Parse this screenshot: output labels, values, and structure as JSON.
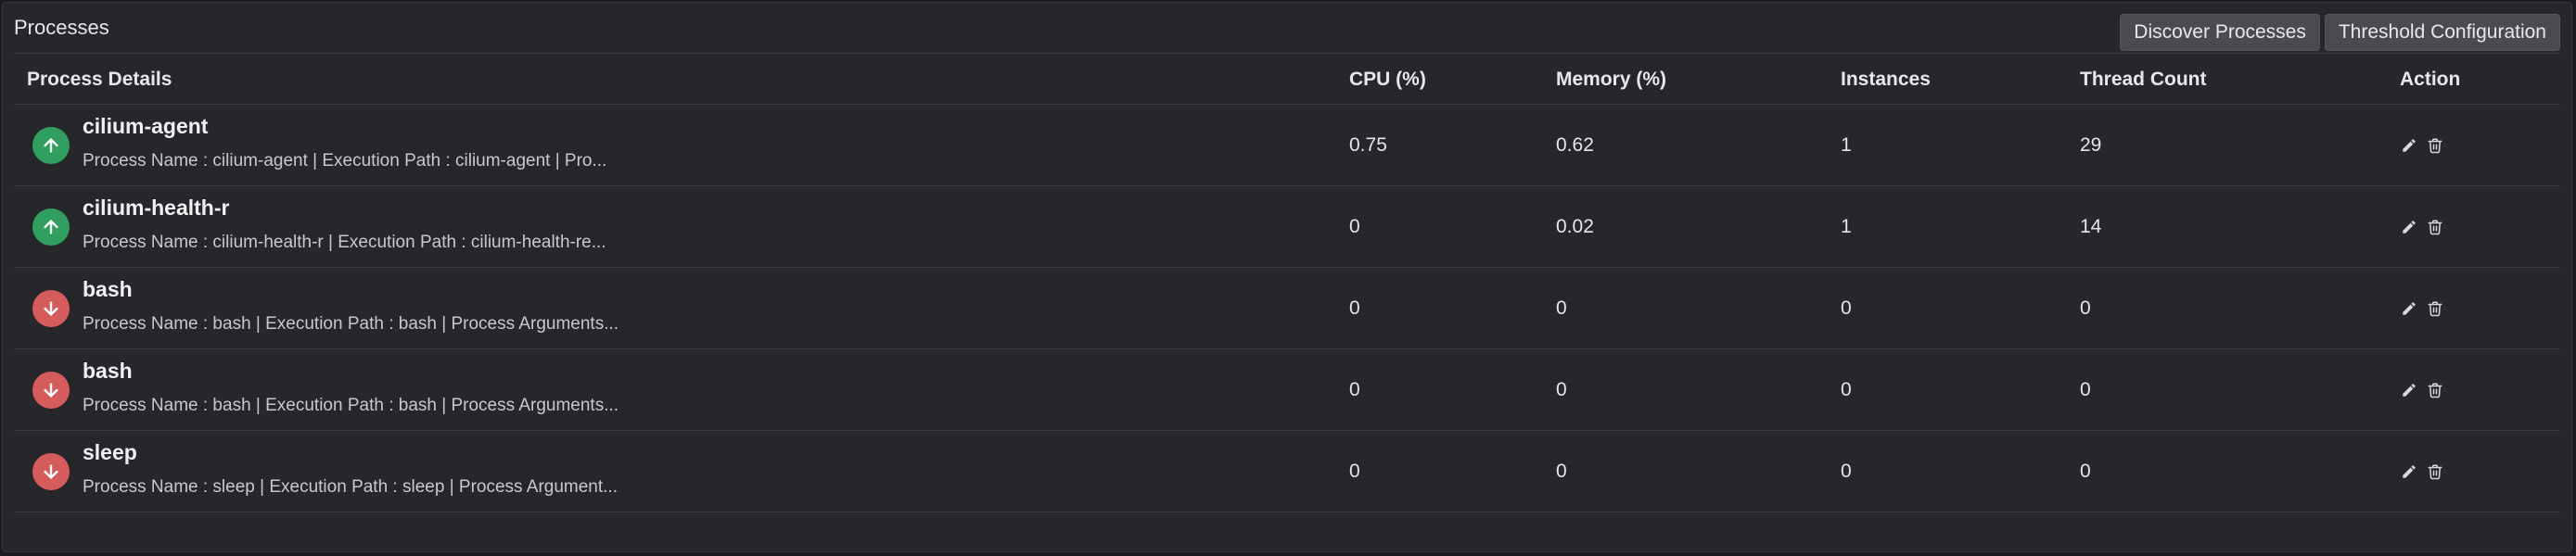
{
  "panel": {
    "title": "Processes",
    "buttons": {
      "discover": "Discover Processes",
      "threshold": "Threshold Configuration"
    }
  },
  "table": {
    "columns": {
      "details": "Process Details",
      "cpu": "CPU (%)",
      "memory": "Memory (%)",
      "instances": "Instances",
      "threads": "Thread Count",
      "action": "Action"
    },
    "rows": [
      {
        "status": "up",
        "name": "cilium-agent",
        "description": "Process Name : cilium-agent | Execution Path : cilium-agent | Pro...",
        "cpu": "0.75",
        "memory": "0.62",
        "instances": "1",
        "threads": "29"
      },
      {
        "status": "up",
        "name": "cilium-health-r",
        "description": "Process Name : cilium-health-r | Execution Path : cilium-health-re...",
        "cpu": "0",
        "memory": "0.02",
        "instances": "1",
        "threads": "14"
      },
      {
        "status": "down",
        "name": "bash",
        "description": "Process Name : bash | Execution Path : bash | Process Arguments...",
        "cpu": "0",
        "memory": "0",
        "instances": "0",
        "threads": "0"
      },
      {
        "status": "down",
        "name": "bash",
        "description": "Process Name : bash | Execution Path : bash | Process Arguments...",
        "cpu": "0",
        "memory": "0",
        "instances": "0",
        "threads": "0"
      },
      {
        "status": "down",
        "name": "sleep",
        "description": "Process Name : sleep | Execution Path : sleep | Process Argument...",
        "cpu": "0",
        "memory": "0",
        "instances": "0",
        "threads": "0"
      }
    ]
  },
  "colors": {
    "status_up": "#2f9e5e",
    "status_down": "#d65c5c",
    "background": "#26272b"
  },
  "icons": {
    "status_up": "arrow-up-icon",
    "status_down": "arrow-down-icon",
    "edit": "pencil-icon",
    "delete": "trash-icon"
  }
}
